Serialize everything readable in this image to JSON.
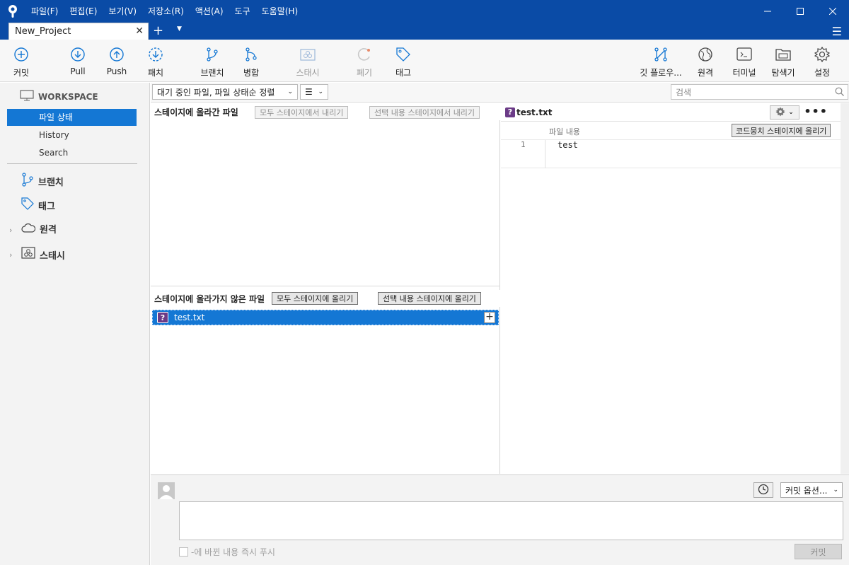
{
  "menu": [
    "파일(F)",
    "편집(E)",
    "보기(V)",
    "저장소(R)",
    "액션(A)",
    "도구",
    "도움말(H)"
  ],
  "tab": {
    "label": "New_Project"
  },
  "toolbar": {
    "commit": "커밋",
    "pull": "Pull",
    "push": "Push",
    "fetch": "패치",
    "branch": "브랜치",
    "merge": "병합",
    "stash": "스태시",
    "discard": "폐기",
    "tag": "태그",
    "gitflow": "깃 플로우...",
    "remote": "원격",
    "terminal": "터미널",
    "explorer": "탐색기",
    "settings": "설정"
  },
  "sidebar": {
    "workspace": "WORKSPACE",
    "items": [
      "파일 상태",
      "History",
      "Search"
    ],
    "groups": {
      "branch": "브랜치",
      "tag": "태그",
      "remote": "원격",
      "stash": "스태시"
    }
  },
  "filter": {
    "sort": "대기 중인 파일, 파일 상태순 정렬",
    "search_placeholder": "검색"
  },
  "staged": {
    "title": "스테이지에 올라간 파일",
    "unstage_all": "모두 스테이지에서 내리기",
    "unstage_selected": "선택 내용 스테이지에서 내리기"
  },
  "unstaged": {
    "title": "스테이지에 올라가지 않은 파일",
    "stage_all": "모두 스테이지에 올리기",
    "stage_selected": "선택 내용 스테이지에 올리기",
    "files": [
      {
        "name": "test.txt",
        "status": "?"
      }
    ]
  },
  "diff": {
    "file": "test.txt",
    "hunk_label": "파일 내용",
    "stage_hunk": "코드뭉치 스테이지에 올리기",
    "lines": [
      {
        "no": "1",
        "text": "test"
      }
    ]
  },
  "commit": {
    "options": "커밋 옵션...",
    "push_immediately": "-에 바뀐 내용 즉시 푸시",
    "button": "커밋"
  },
  "colors": {
    "accent": "#1477d4",
    "titlebar": "#0a4ba6",
    "untracked": "#6b3b87"
  }
}
